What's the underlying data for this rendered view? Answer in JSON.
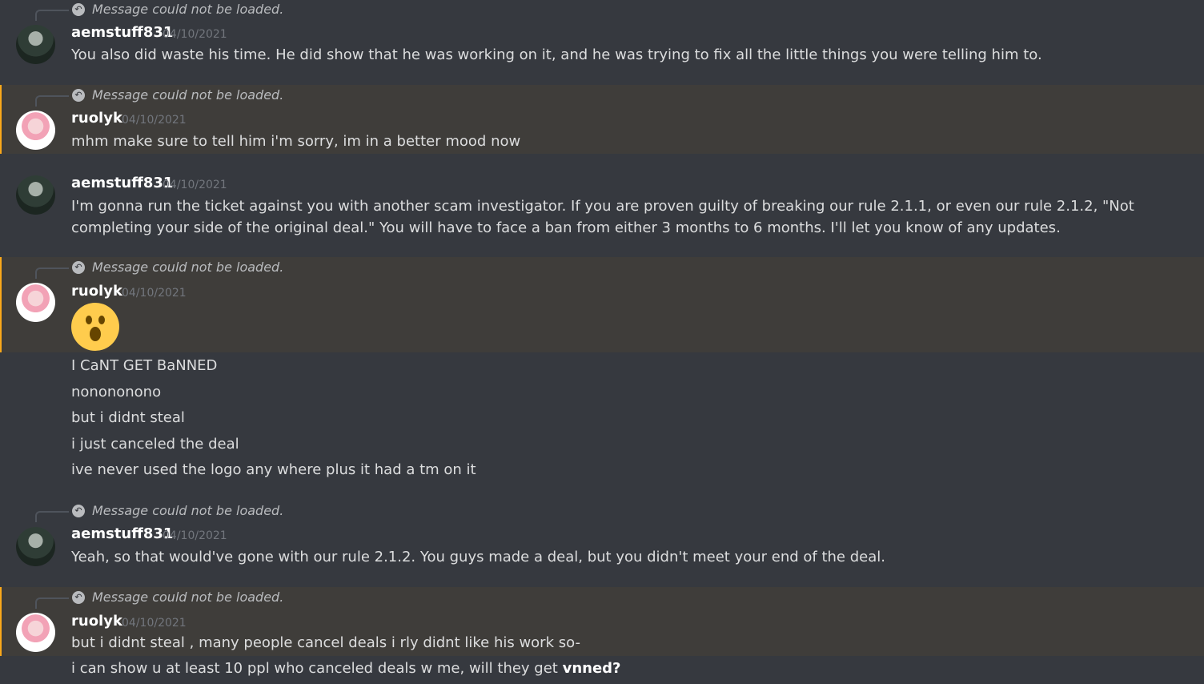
{
  "reply_preview": "Message could not be loaded.",
  "messages": [
    {
      "author": "aemstuff831",
      "timestamp": "04/10/2021",
      "text": "You also did waste his time. He did show that he was working on it, and he was trying to fix all the little things you were telling him to."
    },
    {
      "author": "ruolyk",
      "timestamp": "04/10/2021",
      "text": "mhm make sure to tell him i'm sorry, im in a better mood now"
    },
    {
      "author": "aemstuff831",
      "timestamp": "04/10/2021",
      "text": "I'm gonna run the ticket against you with another scam investigator. If you are proven guilty of breaking our rule 2.1.1, or even our rule 2.1.2, \"Not completing your side of the original deal.\" You will have to face a ban from either 3 months to 6 months. I'll let you know of any updates."
    },
    {
      "author": "ruolyk",
      "timestamp": "04/10/2021",
      "emoji": "open-mouth-emoji",
      "followups": [
        "I CaNT GET BaNNED",
        "nonononono",
        "but i didnt steal",
        "i just canceled the deal",
        "ive never used the logo any where plus it had a tm on it"
      ]
    },
    {
      "author": "aemstuff831",
      "timestamp": "04/10/2021",
      "text": "Yeah, so that would've gone with our rule 2.1.2. You guys made a deal, but you didn't meet your end of the deal."
    },
    {
      "author": "ruolyk",
      "timestamp": "04/10/2021",
      "text": "but i didnt steal , many people cancel deals i rly didnt like his work so-",
      "followup_prefix": "i can show u at least 10 ppl who canceled deals w me, will they get ",
      "followup_bold": "vnned?"
    }
  ]
}
